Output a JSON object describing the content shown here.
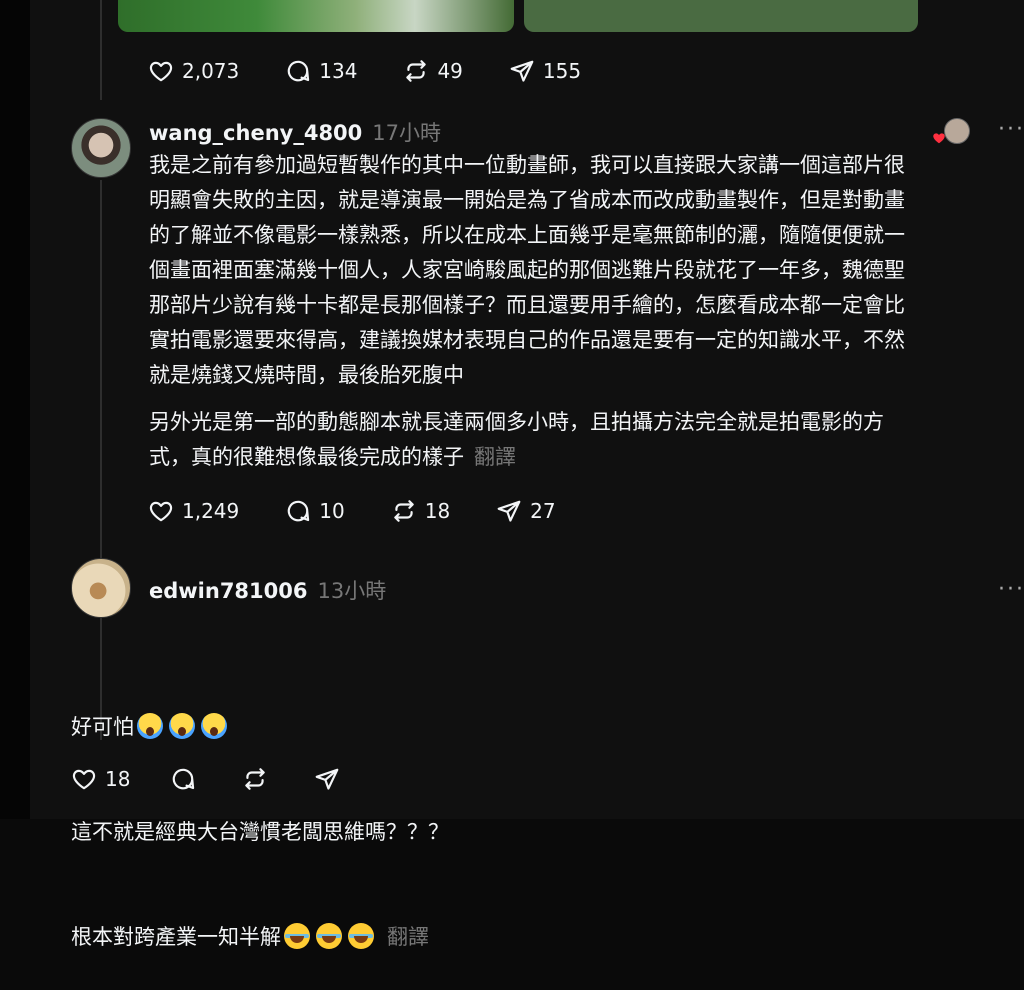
{
  "top_post": {
    "stats": {
      "likes": "2,073",
      "replies": "134",
      "reposts": "49",
      "shares": "155"
    }
  },
  "reply1": {
    "username": "wang_cheny_4800",
    "time": "17小時",
    "paragraph1": "我是之前有參加過短暫製作的其中一位動畫師，我可以直接跟大家講一個這部片很\n明顯會失敗的主因，就是導演最一開始是為了省成本而改成動畫製作，但是對動畫\n的了解並不像電影一樣熟悉，所以在成本上面幾乎是毫無節制的灑，隨隨便便就一\n個畫面裡面塞滿幾十個人，人家宮崎駿風起的那個逃難片段就花了一年多，魏德聖\n那部片少說有幾十卡都是長那個樣子？而且還要用手繪的，怎麼看成本都一定會比\n實拍電影還要來得高，建議換媒材表現自己的作品還是要有一定的知識水平，不然\n就是燒錢又燒時間，最後胎死腹中",
    "paragraph2": "另外光是第一部的動態腳本就長達兩個多小時，且拍攝方法完全就是拍電影的方\n式，真的很難想像最後完成的樣子",
    "translate": "翻譯",
    "stats": {
      "likes": "1,249",
      "replies": "10",
      "reposts": "18",
      "shares": "27"
    }
  },
  "reply2": {
    "username": "edwin781006",
    "time": "13小時",
    "line1": "好可怕",
    "line2": "這不就是經典大台灣慣老闆思維嗎？？？",
    "line3": "根本對跨產業一知半解",
    "translate": "翻譯",
    "stats": {
      "likes": "18"
    }
  },
  "icons": {
    "like": "heart-icon",
    "reply": "comment-icon",
    "repost": "repost-icon",
    "share": "send-icon",
    "more": "more-icon",
    "emoji1": "face-screaming-emoji",
    "emoji2": "tears-of-joy-emoji"
  },
  "colors": {
    "background": "#101010",
    "text": "#f3f5f7",
    "muted": "#777777",
    "heart": "#ff3040"
  }
}
